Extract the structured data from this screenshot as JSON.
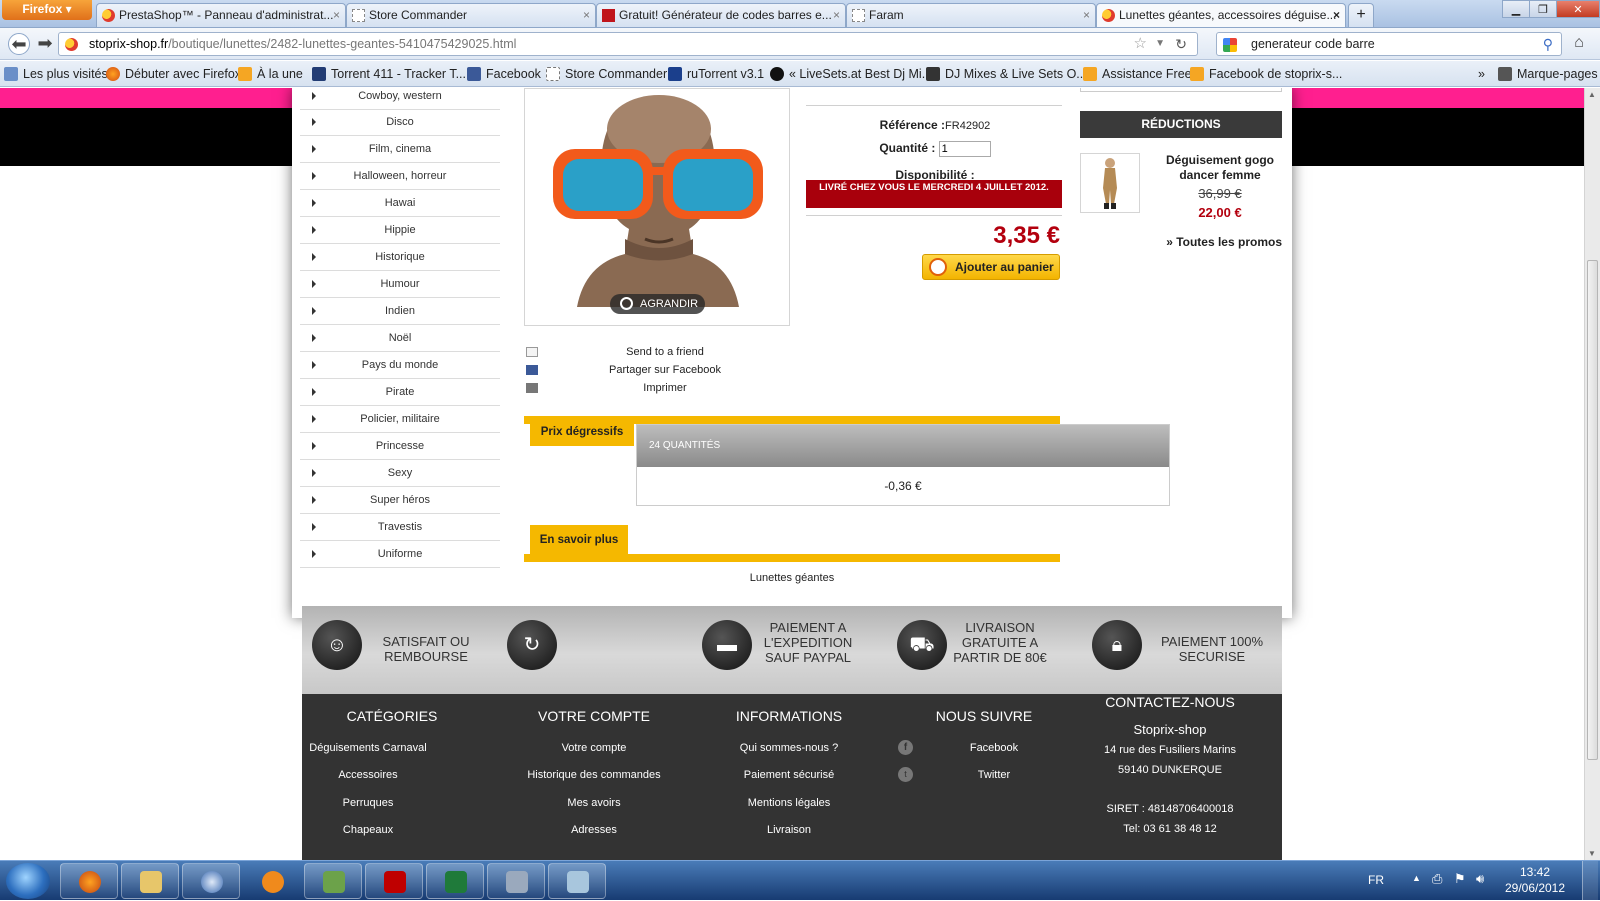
{
  "browser": {
    "menu_button": "Firefox",
    "tabs": [
      {
        "title": "PrestaShop™ - Panneau d'administrat...",
        "close": "×"
      },
      {
        "title": "Store Commander",
        "close": "×"
      },
      {
        "title": "Gratuit! Générateur de codes barres e...",
        "close": "×"
      },
      {
        "title": "Faram",
        "close": "×"
      },
      {
        "title": "Lunettes géantes, accessoires déguise...",
        "close": "×"
      }
    ],
    "new_tab": "+",
    "url_domain": "stoprix-shop.fr",
    "url_path": "/boutique/lunettes/2482-lunettes-geantes-5410475429025.html",
    "search_value": "generateur code barre",
    "bookmarks": [
      "Les plus visités",
      "Débuter avec Firefox",
      "À la une",
      "Torrent 411 - Tracker T...",
      "Facebook",
      "Store Commander",
      "ruTorrent v3.1",
      "« LiveSets.at Best Dj Mi...",
      "DJ Mixes & Live Sets O...",
      "Assistance Free",
      "Facebook de stoprix-s..."
    ],
    "bookmarks_more": "»",
    "bookmarks_menu": "Marque-pages"
  },
  "categories": [
    "Cowboy, western",
    "Disco",
    "Film, cinema",
    "Halloween, horreur",
    "Hawai",
    "Hippie",
    "Historique",
    "Humour",
    "Indien",
    "Noël",
    "Pays du monde",
    "Pirate",
    "Policier, militaire",
    "Princesse",
    "Sexy",
    "Super héros",
    "Travestis",
    "Uniforme"
  ],
  "product": {
    "zoom_label": "AGRANDIR",
    "reference_label": "Référence :",
    "reference": "FR42902",
    "quantity_label": "Quantité :",
    "quantity": "1",
    "availability_label": "Disponibilité :",
    "delivery": "LIVRÉ CHEZ VOUS LE MERCREDI 4 JUILLET 2012.",
    "price": "3,35 €",
    "add_to_cart": "Ajouter au panier"
  },
  "share": {
    "send": "Send to a friend",
    "facebook": "Partager sur Facebook",
    "print": "Imprimer"
  },
  "tabs": {
    "degressive": "Prix dégressifs",
    "qty_header": "24 QUANTITÉS",
    "qty_value": "-0,36 €",
    "more": "En savoir plus",
    "more_text": "Lunettes géantes"
  },
  "reductions": {
    "title": "RÉDUCTIONS",
    "item_name": "Déguisement gogo dancer femme",
    "old_price": "36,99 €",
    "new_price": "22,00 €",
    "all_link": "» Toutes les promos"
  },
  "guarantees": [
    {
      "icon": "smile-icon",
      "text": "SATISFAIT OU REMBOURSE"
    },
    {
      "icon": "refresh-icon",
      "text": ""
    },
    {
      "icon": "card-icon",
      "text": "PAIEMENT A L'EXPEDITION SAUF PAYPAL"
    },
    {
      "icon": "truck-icon",
      "text": "LIVRAISON GRATUITE A PARTIR DE 80€"
    },
    {
      "icon": "lock-icon",
      "text": "PAIEMENT 100% SECURISE"
    }
  ],
  "footer": {
    "categories_title": "CATÉGORIES",
    "categories": [
      "Déguisements Carnaval",
      "Accessoires",
      "Perruques",
      "Chapeaux"
    ],
    "account_title": "VOTRE COMPTE",
    "account": [
      "Votre compte",
      "Historique des commandes",
      "Mes avoirs",
      "Adresses"
    ],
    "info_title": "INFORMATIONS",
    "info": [
      "Qui sommes-nous ?",
      "Paiement sécurisé",
      "Mentions légales",
      "Livraison"
    ],
    "follow_title": "NOUS SUIVRE",
    "follow": [
      "Facebook",
      "Twitter"
    ],
    "contact_title": "CONTACTEZ-NOUS",
    "contact_name": "Stoprix-shop",
    "contact_address1": "14 rue des Fusiliers Marins",
    "contact_address2": "59140 DUNKERQUE",
    "contact_siret": "SIRET : 48148706400018",
    "contact_phone": "Tel: 03 61 38 48 12"
  },
  "taskbar": {
    "lang": "FR",
    "time": "13:42",
    "date": "29/06/2012"
  },
  "colors": {
    "pink": "#ff1f8f",
    "accent_yellow": "#f5b800",
    "price_red": "#b3000e"
  }
}
